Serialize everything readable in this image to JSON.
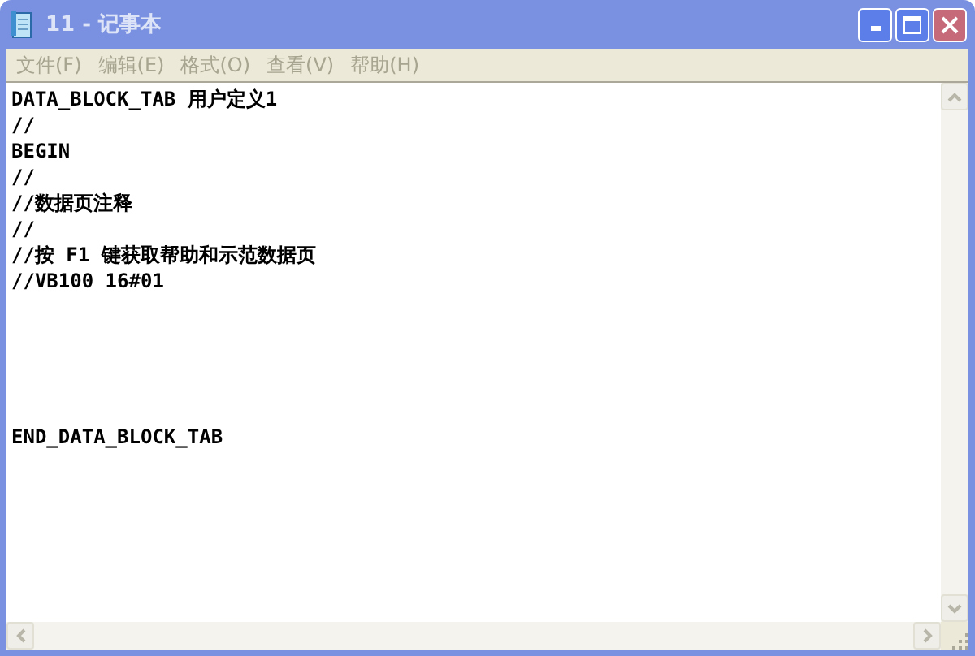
{
  "window": {
    "title": "11 - 记事本",
    "active": false
  },
  "menu": [
    {
      "label": "文件(F)"
    },
    {
      "label": "编辑(E)"
    },
    {
      "label": "格式(O)"
    },
    {
      "label": "查看(V)"
    },
    {
      "label": "帮助(H)"
    }
  ],
  "editor": {
    "text": "DATA_BLOCK_TAB 用户定义1\n//\nBEGIN\n//\n//数据页注释\n//\n//按 F1 键获取帮助和示范数据页\n//VB100 16#01\n\n\n\n\n\nEND_DATA_BLOCK_TAB"
  }
}
